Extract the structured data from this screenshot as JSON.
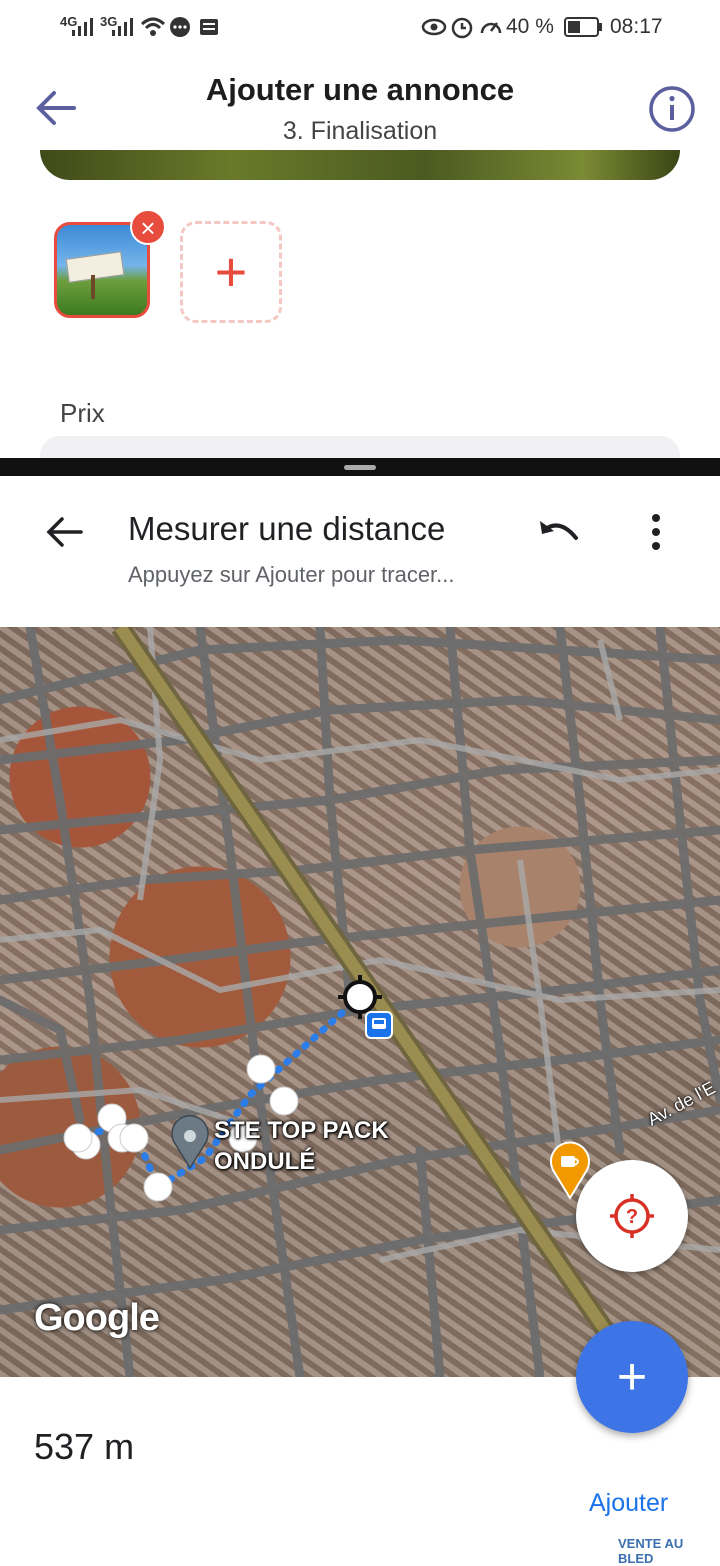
{
  "status_bar": {
    "network1": "4G",
    "network2": "3G",
    "battery": "40 %",
    "time": "08:17"
  },
  "app": {
    "title": "Ajouter une annonce",
    "subtitle": "3. Finalisation",
    "price_label": "Prix",
    "remove_symbol": "×",
    "add_symbol": "+"
  },
  "maps": {
    "title": "Mesurer une distance",
    "subtitle": "Appuyez sur Ajouter pour tracer...",
    "poi_label_line1": "STE TOP PACK",
    "poi_label_line2": "ONDULÉ",
    "street_label": "Av. de l'E",
    "google_logo": "Google",
    "distance": "537 m",
    "add_label": "Ajouter",
    "fab_symbol": "+"
  },
  "watermark": "VENTE AU BLED",
  "colors": {
    "accent_red": "#e84c3d",
    "maps_blue": "#1a73e8",
    "fab_blue": "#3d74e6"
  }
}
